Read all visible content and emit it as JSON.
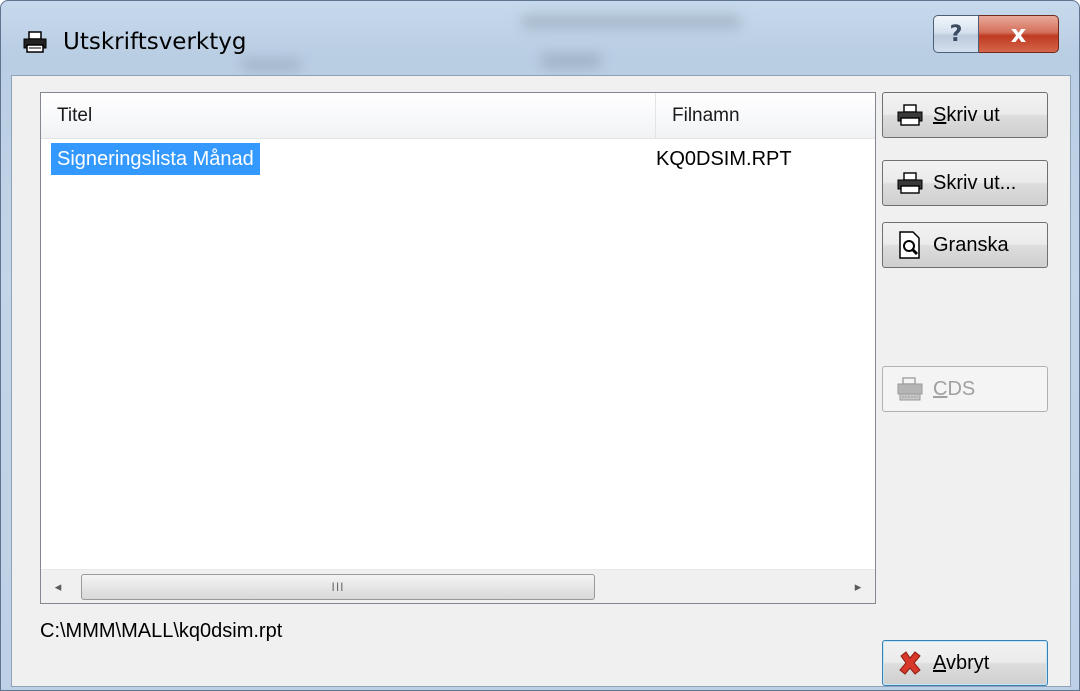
{
  "window": {
    "title": "Utskriftsverktyg",
    "help_label": "?",
    "close_label": "x"
  },
  "list": {
    "columns": [
      "Titel",
      "Filnamn"
    ],
    "rows": [
      {
        "title": "Signeringslista Månad",
        "filename": "KQ0DSIM.RPT",
        "selected": true
      }
    ],
    "scroll_left": "◂",
    "scroll_right": "▸",
    "scroll_grip": "III"
  },
  "buttons": {
    "print": {
      "hotkey": "S",
      "rest": "kriv ut"
    },
    "print_dialog": {
      "label": "Skriv ut..."
    },
    "preview": {
      "label": "Granska"
    },
    "cds": {
      "hotkey": "C",
      "rest": "DS"
    },
    "cancel": {
      "hotkey": "A",
      "rest": "vbryt"
    }
  },
  "status": {
    "path": "C:\\MMM\\MALL\\kq0dsim.rpt"
  },
  "colors": {
    "selection": "#3399ff",
    "close_button": "#c7452c"
  }
}
